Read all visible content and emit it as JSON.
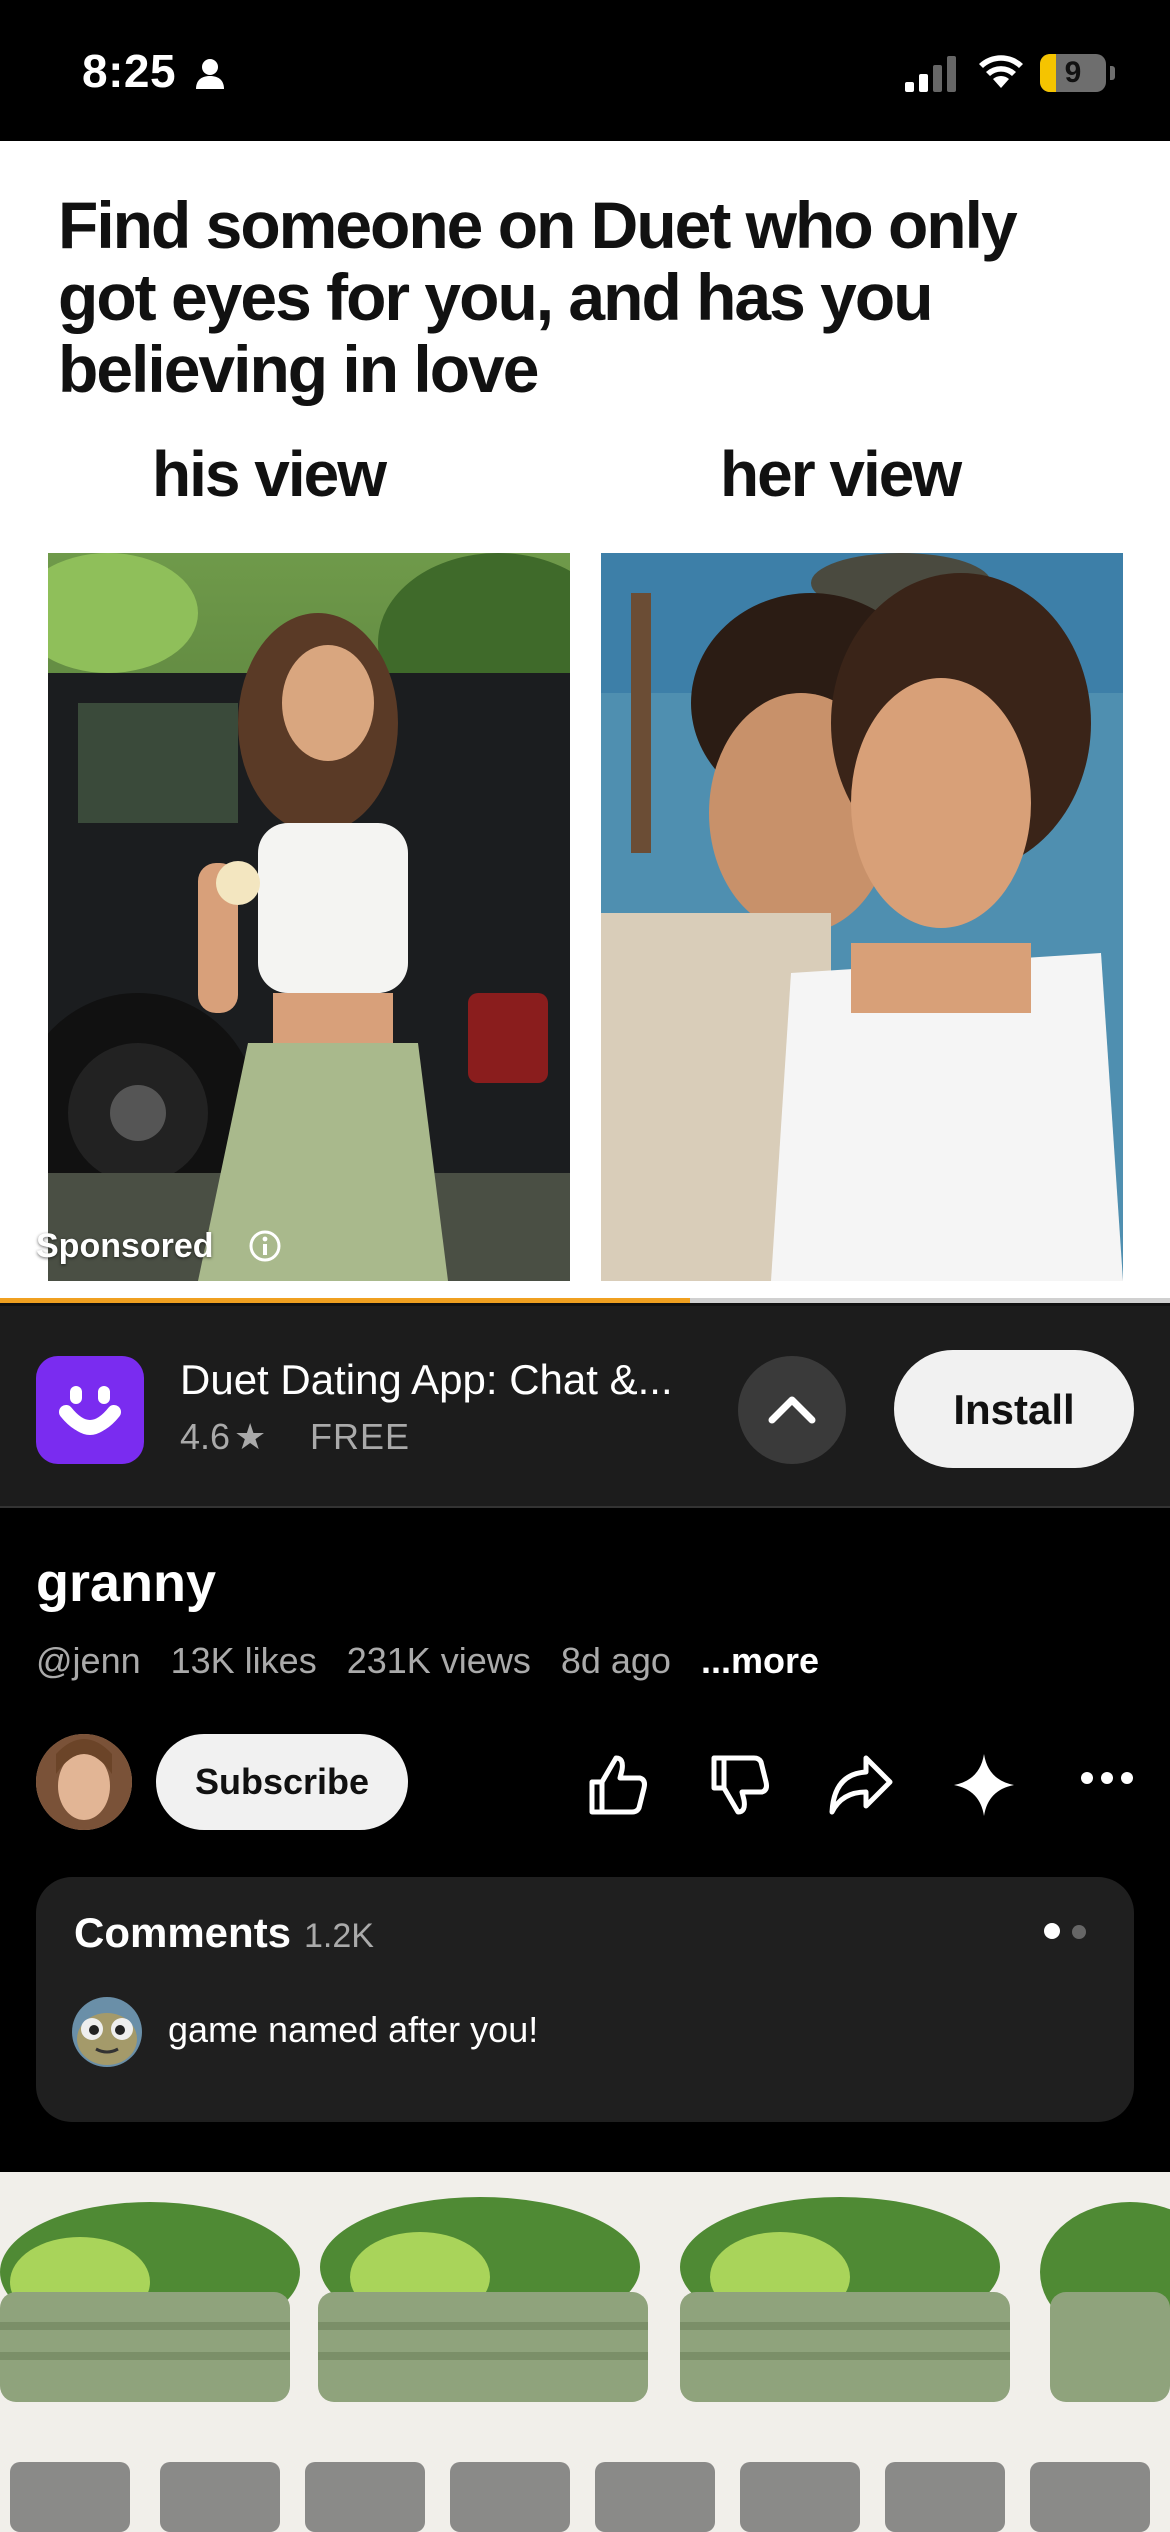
{
  "status_bar": {
    "time": "8:25",
    "battery": "9"
  },
  "ad": {
    "headline": "Find someone on Duet who only got eyes for you, and has you believing in love",
    "left_label": "his view",
    "right_label": "her view",
    "sponsored": "Sponsored",
    "progress": 0.59
  },
  "app": {
    "name": "Duet Dating App: Chat &...",
    "rating": "4.6",
    "price": "FREE",
    "install_label": "Install",
    "icon_color": "#7a2cf0"
  },
  "video": {
    "title": "granny",
    "channel": "@jenn",
    "likes": "13K likes",
    "views": "231K views",
    "age": "8d ago",
    "more": "...more",
    "subscribe_label": "Subscribe"
  },
  "comments": {
    "title": "Comments",
    "count": "1.2K",
    "top_comment": "game named after you!"
  },
  "icons": [
    "person-icon",
    "cellular-signal-icon",
    "wifi-icon",
    "battery-icon",
    "info-icon",
    "duet-app-icon",
    "chevron-up-icon",
    "star-icon",
    "like-icon",
    "dislike-icon",
    "share-icon",
    "sparkle-icon",
    "more-icon"
  ]
}
